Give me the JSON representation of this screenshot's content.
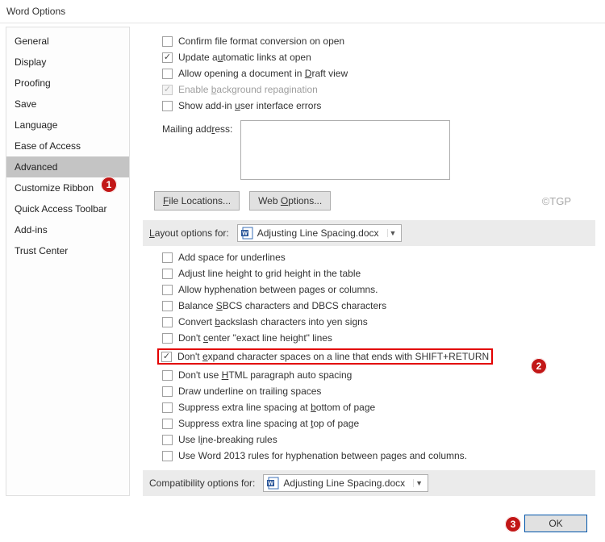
{
  "title": "Word Options",
  "sidebar": {
    "items": [
      {
        "label": "General"
      },
      {
        "label": "Display"
      },
      {
        "label": "Proofing"
      },
      {
        "label": "Save"
      },
      {
        "label": "Language"
      },
      {
        "label": "Ease of Access"
      },
      {
        "label": "Advanced"
      },
      {
        "label": "Customize Ribbon"
      },
      {
        "label": "Quick Access Toolbar"
      },
      {
        "label": "Add-ins"
      },
      {
        "label": "Trust Center"
      }
    ]
  },
  "general": {
    "confirm_format": "Confirm file format conversion on open",
    "update_links_pre": "Update a",
    "update_links_u": "u",
    "update_links_post": "tomatic links at open",
    "allow_draft_pre": "Allow opening a document in ",
    "allow_draft_u": "D",
    "allow_draft_post": "raft view",
    "bg_repag_pre": "Enable ",
    "bg_repag_u": "b",
    "bg_repag_post": "ackground repagination",
    "ui_errors_pre": "Show add-in ",
    "ui_errors_u": "u",
    "ui_errors_post": "ser interface errors",
    "mail_label": "Mailing add",
    "mail_u": "r",
    "mail_post": "ess:"
  },
  "buttons": {
    "file_loc_u": "F",
    "file_loc_post": "ile Locations...",
    "web_opt_pre": "Web ",
    "web_opt_u": "O",
    "web_opt_post": "ptions...",
    "ok": "OK"
  },
  "watermark": "©TGP",
  "layout_header_u": "L",
  "layout_header_post": "ayout options for:",
  "doc_name": "Adjusting Line Spacing.docx",
  "layout_opts": {
    "o0": "Add space for underlines",
    "o1": "Adjust line height to grid height in the table",
    "o2": "Allow hyphenation between pages or columns.",
    "o3_pre": "Balance ",
    "o3_u": "S",
    "o3_post": "BCS characters and DBCS characters",
    "o4_pre": "Convert ",
    "o4_u": "b",
    "o4_post": "ackslash characters into yen signs",
    "o5_pre": "Don't ",
    "o5_u": "c",
    "o5_post": "enter \"exact line height\" lines",
    "o6_pre": "Don't ",
    "o6_u": "e",
    "o6_post": "xpand character spaces on a line that ends with SHIFT+RETURN",
    "o7_pre": "Don't use ",
    "o7_u": "H",
    "o7_post": "TML paragraph auto spacing",
    "o8": "Draw underline on trailing spaces",
    "o9_pre": "Suppress extra line spacing at ",
    "o9_u": "b",
    "o9_post": "ottom of page",
    "o10_pre": "Suppress extra line spacing at ",
    "o10_u": "t",
    "o10_post": "op of page",
    "o11_pre": "Use l",
    "o11_u": "i",
    "o11_post": "ne-breaking rules",
    "o12": "Use Word 2013 rules for hyphenation between pages and columns."
  },
  "compat_header": "Compatibility options for:",
  "badges": {
    "b1": "1",
    "b2": "2",
    "b3": "3"
  }
}
